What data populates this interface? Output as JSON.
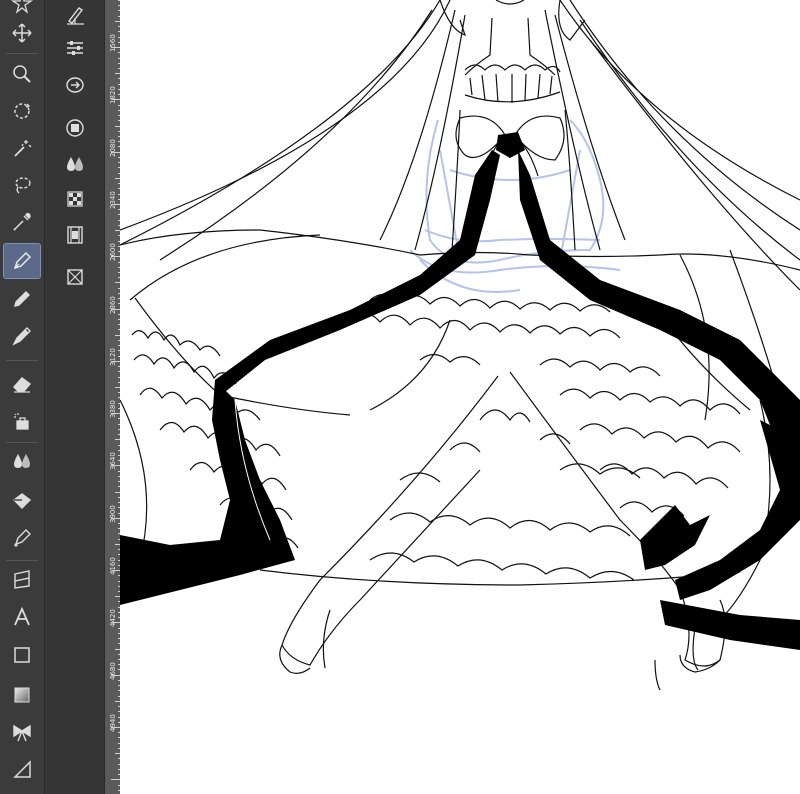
{
  "app": {
    "accent_color": "#5c6a8a"
  },
  "toolbar": {
    "tools": [
      {
        "name": "move-icon",
        "label": "Move"
      },
      {
        "name": "zoom-icon",
        "label": "Zoom"
      },
      {
        "name": "rotate-view-icon",
        "label": "Rotate"
      },
      {
        "name": "auto-select-icon",
        "label": "Auto select"
      },
      {
        "name": "lasso-icon",
        "label": "Lasso"
      },
      {
        "name": "eyedropper-icon",
        "label": "Eyedropper"
      },
      {
        "name": "pen-icon",
        "label": "Pen",
        "active": true
      },
      {
        "name": "pencil-icon",
        "label": "Pencil"
      },
      {
        "name": "marker-icon",
        "label": "Marker"
      },
      {
        "name": "eraser-icon",
        "label": "Eraser"
      },
      {
        "name": "airbrush-icon",
        "label": "Airbrush"
      },
      {
        "name": "blend-icon",
        "label": "Blend"
      },
      {
        "name": "fill-icon",
        "label": "Fill"
      },
      {
        "name": "vector-pen-icon",
        "label": "Vector"
      },
      {
        "name": "frame-icon",
        "label": "Frame"
      },
      {
        "name": "text-icon",
        "label": "Text"
      },
      {
        "name": "rectangle-icon",
        "label": "Figure"
      },
      {
        "name": "gradient-icon",
        "label": "Gradient"
      },
      {
        "name": "ribbon-icon",
        "label": "Decoration"
      },
      {
        "name": "ruler-icon",
        "label": "Ruler"
      }
    ]
  },
  "subtoolbar": {
    "items": [
      {
        "name": "brush-settings-icon"
      },
      {
        "name": "sliders-icon"
      },
      {
        "name": "sync-icon"
      },
      {
        "name": "layer-icon"
      },
      {
        "name": "color-drops-icon"
      },
      {
        "name": "palette-grid-icon"
      },
      {
        "name": "film-icon"
      },
      {
        "name": "navigator-icon"
      }
    ]
  },
  "ruler": {
    "labels": [
      "1560",
      "1820",
      "2080",
      "2340",
      "2600",
      "2860",
      "3120",
      "3380",
      "3640",
      "3900",
      "4160",
      "4420",
      "4680",
      "4940"
    ]
  }
}
